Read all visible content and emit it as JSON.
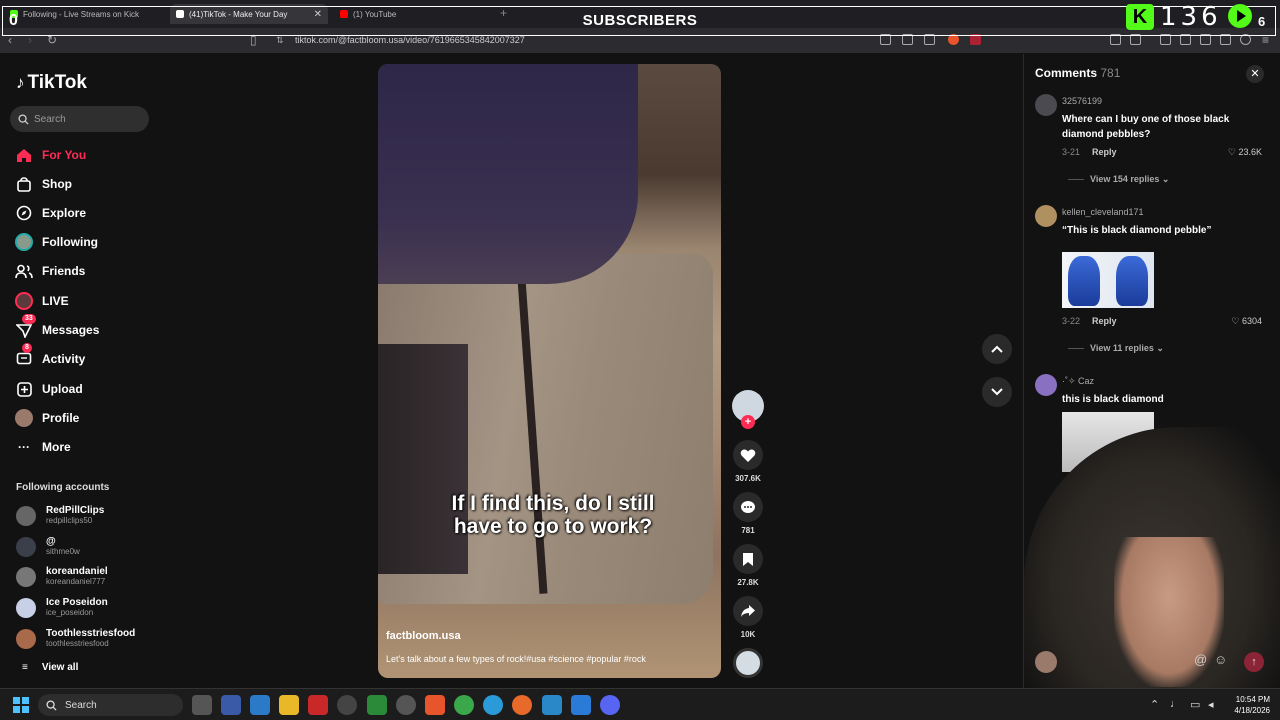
{
  "browser": {
    "tabs": [
      {
        "title": "Following - Live Streams on Kick",
        "color": "#53fc18"
      },
      {
        "title": "(41)TikTok - Make Your Day",
        "color": "#ffffff"
      },
      {
        "title": "(1) YouTube",
        "color": "#ff0000"
      }
    ],
    "close_glyph": "✕",
    "new_tab_glyph": "+",
    "url": "tiktok.com/@factbloom.usa/video/7619665345842007327"
  },
  "stream_overlay": {
    "label": "SUBSCRIBERS",
    "kick_count": "0",
    "kick_glyph": "K",
    "subscriber_count": "136",
    "youtube_count": "6"
  },
  "sidebar": {
    "logo_text": "TikTok",
    "search_placeholder": "Search",
    "nav": [
      {
        "label": "For You",
        "icon": "home-icon",
        "active": true
      },
      {
        "label": "Shop",
        "icon": "shop-icon"
      },
      {
        "label": "Explore",
        "icon": "compass-icon"
      },
      {
        "label": "Following",
        "icon": "following-avatar-icon"
      },
      {
        "label": "Friends",
        "icon": "friends-icon"
      },
      {
        "label": "LIVE",
        "icon": "live-avatar-icon"
      },
      {
        "label": "Messages",
        "icon": "messages-icon",
        "badge": "33"
      },
      {
        "label": "Activity",
        "icon": "activity-icon",
        "badge": "8"
      },
      {
        "label": "Upload",
        "icon": "upload-icon"
      },
      {
        "label": "Profile",
        "icon": "profile-avatar-icon"
      },
      {
        "label": "More",
        "icon": "more-dots-icon"
      }
    ],
    "following_header": "Following accounts",
    "accounts": [
      {
        "name": "RedPillClips",
        "handle": "redpillclips50"
      },
      {
        "name": "@",
        "handle": "sithme0w"
      },
      {
        "name": "koreandaniel",
        "handle": "koreandaniel777"
      },
      {
        "name": "Ice Poseidon",
        "handle": "ice_poseidon"
      },
      {
        "name": "Toothlesstriesfood",
        "handle": "toothlesstriesfood"
      }
    ],
    "view_all": "View all"
  },
  "video": {
    "caption_line1": "If I find this, do I still",
    "caption_line2": "have to go to work?",
    "author": "factbloom.usa",
    "description": "Let's talk about a few types of rock!#usa #science #popular #rock"
  },
  "actions": {
    "likes": "307.6K",
    "comments": "781",
    "saves": "27.8K",
    "shares": "10K",
    "follow_glyph": "+"
  },
  "comments_panel": {
    "title": "Comments",
    "count": "781",
    "close_glyph": "✕",
    "reply_label": "Reply",
    "items": [
      {
        "user": "32576199",
        "text": "Where can I buy one of those black diamond pebbles?",
        "date": "3-21",
        "likes": "23.6K",
        "replies": "View 154 replies"
      },
      {
        "user": "kellen_cleveland171",
        "text": "“This is black diamond pebble”",
        "date": "3-22",
        "likes": "6304",
        "replies": "View 11 replies"
      },
      {
        "user": "·˚✧ Caz",
        "text": "this is black diamond"
      }
    ],
    "send_glyph": "↑",
    "mention_glyph": "@",
    "emoji_glyph": "☺"
  },
  "taskbar": {
    "search_label": "Search",
    "time": "10:54 PM",
    "date": "4/18/2026"
  }
}
